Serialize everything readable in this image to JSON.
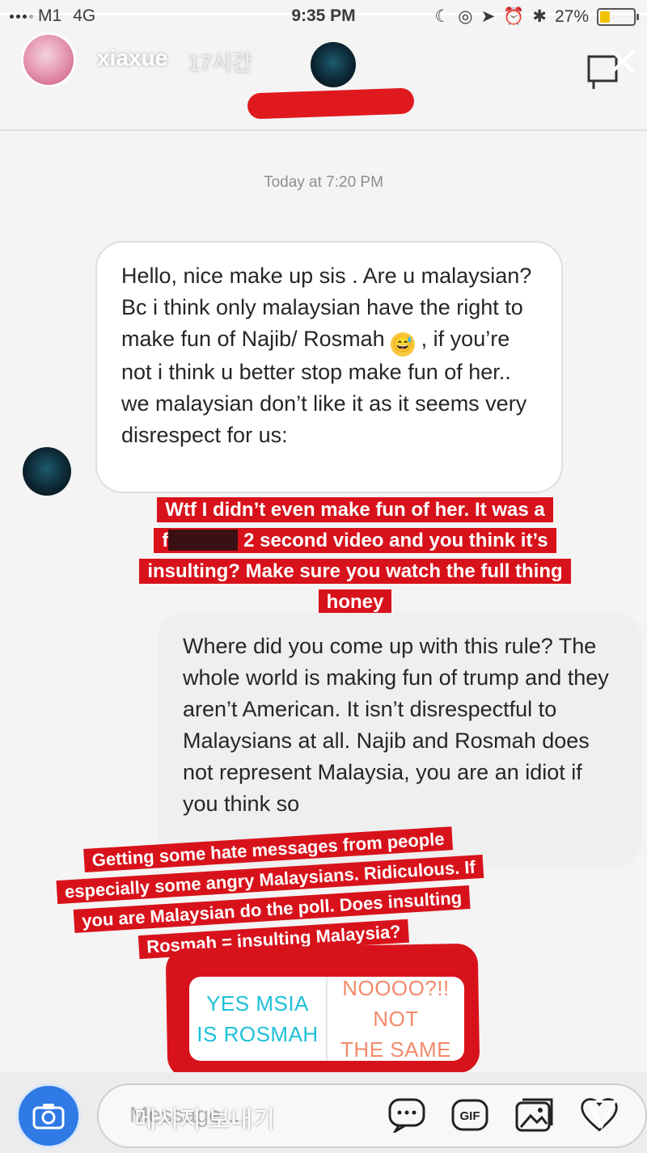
{
  "status_bar": {
    "carrier": "M1",
    "network": "4G",
    "time": "9:35 PM",
    "battery": "27%",
    "battery_level": 0.27
  },
  "story": {
    "username": "xiaxue",
    "time_ago": "17시간",
    "progress": 1.0
  },
  "thread": {
    "date_label": "Today at 7:20 PM"
  },
  "messages": {
    "incoming_part1": "Hello, nice make up sis . Are u malaysian? Bc i think only malaysian have the right to make fun of Najib/ Rosmah",
    "incoming_emoji": "😅",
    "incoming_part2": " , if you’re not i think u better stop make fun of her.. we malaysian don’t like it as it seems very disrespect for us:",
    "outgoing": "Where did you come up with this rule? The whole world is making fun of trump and they aren’t American. It isn’t disrespectful to Malaysians at all. Najib and Rosmah does not represent Malaysia, you are an idiot if you think so"
  },
  "captions": {
    "caption1_a": "Wtf I didn’t even make fun of her. It was a",
    "caption1_b_prefix": "f",
    "caption1_b_suffix": " 2 second video and you think it’s",
    "caption1_c": "insulting? Make sure you watch the full thing",
    "caption1_d": "honey",
    "caption2_a": "Getting some hate messages from people",
    "caption2_b": "especially some angry Malaysians. Ridiculous. If",
    "caption2_c": "you are Malaysian do the poll. Does insulting",
    "caption2_d": "Rosmah = insulting Malaysia?"
  },
  "poll": {
    "option_a_line1": "YES MSIA",
    "option_a_line2": "IS ROSMAH",
    "option_b_line1": "NOOOO?!! NOT",
    "option_b_line2": "THE SAME",
    "color_a": "#1dc0d8",
    "color_b": "#f28a6b"
  },
  "composer": {
    "placeholder_en": "Message...",
    "placeholder_ko": "메시지 보내기"
  },
  "icons": {
    "camera": "camera-icon",
    "chat": "chat-bubble-icon",
    "gif": "gif-icon",
    "gallery": "gallery-icon",
    "heart": "heart-icon",
    "send": "send-icon",
    "close": "close-icon",
    "more": "more-icon"
  },
  "colors": {
    "caption_red": "#d8121b",
    "camera_blue": "#2f7ae5"
  }
}
